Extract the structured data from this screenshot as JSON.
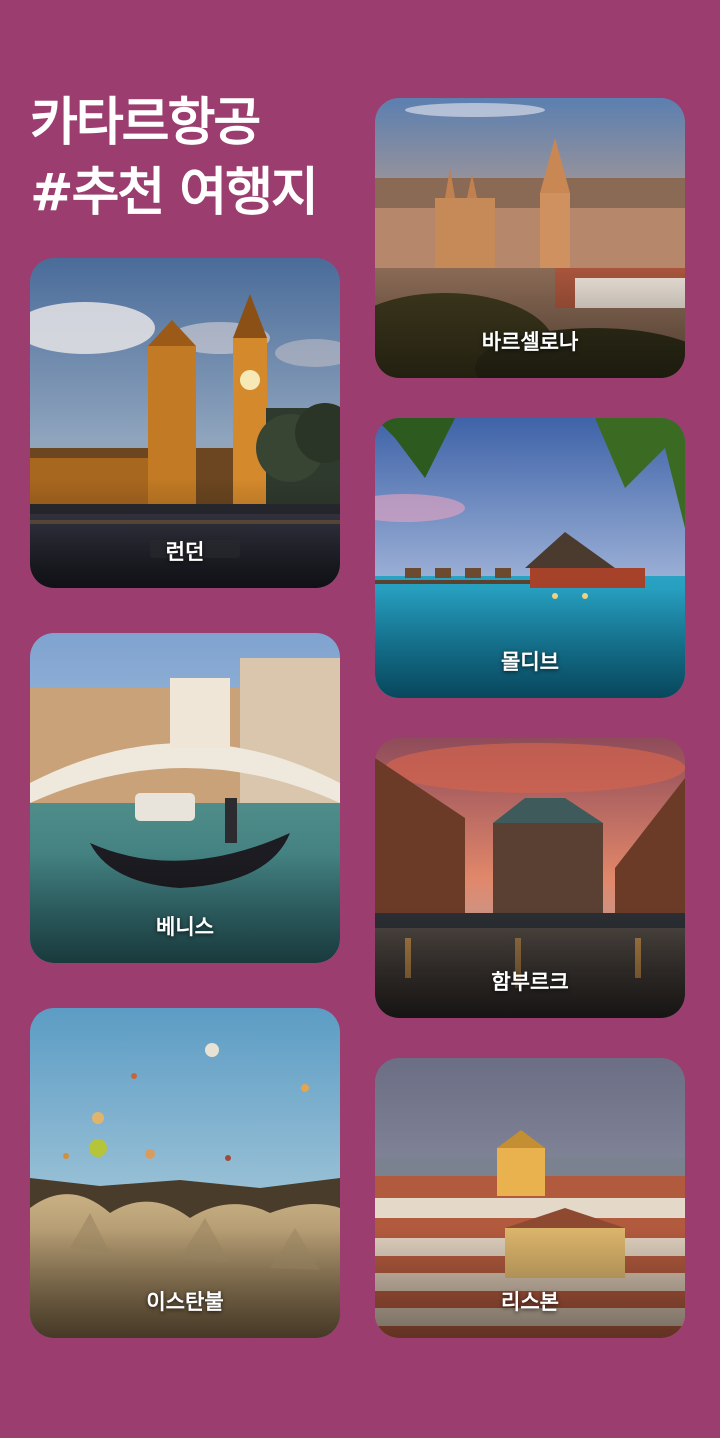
{
  "title": {
    "line1": "카타르항공",
    "line2": "#추천 여행지"
  },
  "destinations": [
    {
      "id": "london",
      "label": "런던"
    },
    {
      "id": "barcelona",
      "label": "바르셀로나"
    },
    {
      "id": "maldives",
      "label": "몰디브"
    },
    {
      "id": "venice",
      "label": "베니스"
    },
    {
      "id": "hamburg",
      "label": "함부르크"
    },
    {
      "id": "istanbul",
      "label": "이스탄불"
    },
    {
      "id": "lisbon",
      "label": "리스본"
    }
  ],
  "colors": {
    "background": "#9b3d6e",
    "text": "#ffffff"
  }
}
